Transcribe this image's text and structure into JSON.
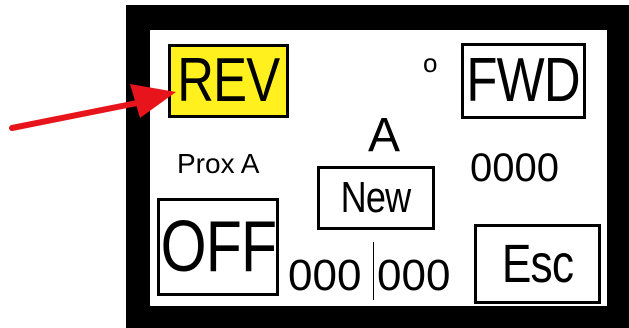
{
  "display": {
    "buttons": {
      "rev": "REV",
      "fwd": "FWD",
      "new": "New",
      "off": "OFF",
      "esc": "Esc"
    },
    "degree_mark": "o",
    "mode_letter": "A",
    "sensor_label": "Prox A",
    "counter": "0000",
    "readout_left": "000",
    "readout_right": "000"
  },
  "colors": {
    "bezel": "#000000",
    "screen": "#ffffff",
    "rev_highlight": "#fff01e",
    "pointer_arrow": "#e8141c"
  },
  "icons": {
    "pointer": "red-arrow-icon"
  }
}
